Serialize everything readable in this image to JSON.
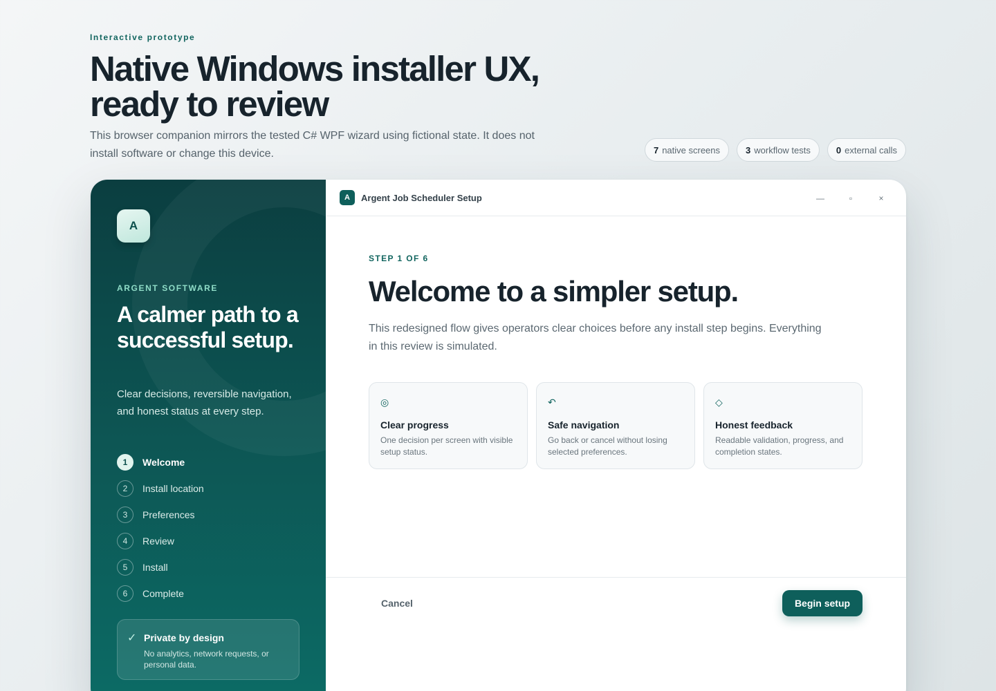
{
  "page": {
    "eyebrow": "Interactive prototype",
    "title_line1": "Native Windows installer UX,",
    "title_line2": "ready to review",
    "subtitle": "This browser companion mirrors the tested C# WPF wizard using fictional state. It does not install software or change this device.",
    "stats": [
      {
        "value": "7",
        "label": "native screens"
      },
      {
        "value": "3",
        "label": "workflow tests"
      },
      {
        "value": "0",
        "label": "external calls"
      }
    ]
  },
  "sidebar": {
    "logo_letter": "A",
    "brand": "ARGENT SOFTWARE",
    "title": "A calmer path to a successful setup.",
    "description": "Clear decisions, reversible navigation, and honest status at every step.",
    "steps": [
      {
        "num": "1",
        "label": "Welcome"
      },
      {
        "num": "2",
        "label": "Install location"
      },
      {
        "num": "3",
        "label": "Preferences"
      },
      {
        "num": "4",
        "label": "Review"
      },
      {
        "num": "5",
        "label": "Install"
      },
      {
        "num": "6",
        "label": "Complete"
      }
    ],
    "privacy": {
      "check": "✓",
      "title": "Private by design",
      "description": "No analytics, network requests, or personal data."
    }
  },
  "window": {
    "logo_letter": "A",
    "title": "Argent Job Scheduler Setup",
    "controls": {
      "minimize": "—",
      "maximize": "▫",
      "close": "×"
    }
  },
  "main": {
    "step_indicator": "STEP 1 OF 6",
    "title": "Welcome to a simpler setup.",
    "description": "This redesigned flow gives operators clear choices before any install step begins. Everything in this review is simulated.",
    "cards": [
      {
        "icon": "◎",
        "title": "Clear progress",
        "description": "One decision per screen with visible setup status."
      },
      {
        "icon": "↶",
        "title": "Safe navigation",
        "description": "Go back or cancel without losing selected preferences."
      },
      {
        "icon": "◇",
        "title": "Honest feedback",
        "description": "Readable validation, progress, and completion states."
      }
    ],
    "cancel_label": "Cancel",
    "begin_label": "Begin setup"
  },
  "colors": {
    "accent": "#0e5f5b",
    "sidebar_top": "#0b3e40",
    "sidebar_bottom": "#0c6b65",
    "brand_mint": "#8fdcc7"
  }
}
